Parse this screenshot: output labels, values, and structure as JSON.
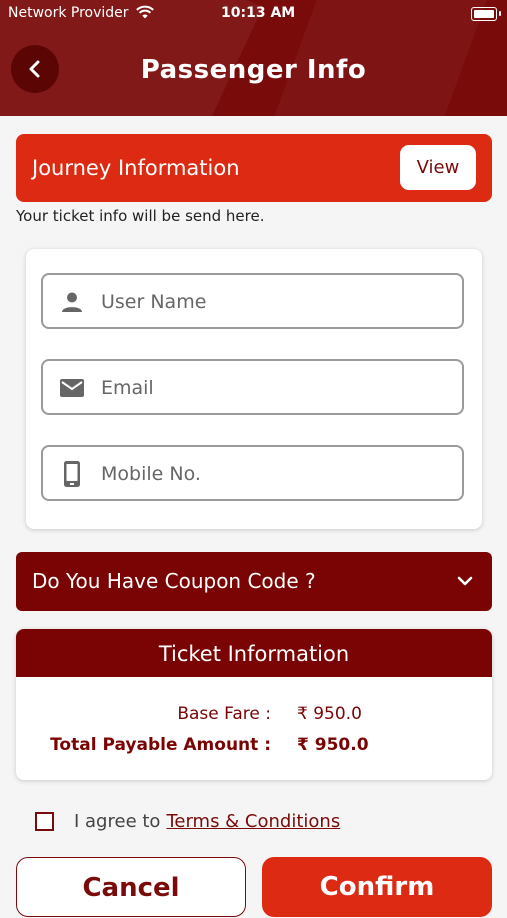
{
  "status_bar": {
    "carrier": "Network Provider",
    "time": "10:13 AM"
  },
  "header": {
    "title": "Passenger Info",
    "back_icon": "chevron-left-icon"
  },
  "journey": {
    "label": "Journey Information",
    "view_label": "View",
    "hint": "Your ticket info will be send here."
  },
  "form": {
    "username": {
      "placeholder": "User Name",
      "value": "",
      "icon": "person-icon"
    },
    "email": {
      "placeholder": "Email",
      "value": "",
      "icon": "mail-icon"
    },
    "mobile": {
      "placeholder": "Mobile No.",
      "value": "",
      "icon": "phone-icon"
    }
  },
  "coupon": {
    "label": "Do You Have Coupon Code ?",
    "icon": "chevron-down-icon"
  },
  "ticket": {
    "title": "Ticket Information",
    "rows": [
      {
        "label": "Base Fare :",
        "value": "₹ 950.0"
      },
      {
        "label": "Total Payable Amount :",
        "value": "₹ 950.0"
      }
    ]
  },
  "agreement": {
    "prefix": "I agree to",
    "link": "Terms & Conditions",
    "checked": false
  },
  "actions": {
    "cancel_label": "Cancel",
    "confirm_label": "Confirm"
  },
  "colors": {
    "primary": "#7a0b0b",
    "accent": "#dd2a12",
    "background": "#f5f5f5"
  }
}
